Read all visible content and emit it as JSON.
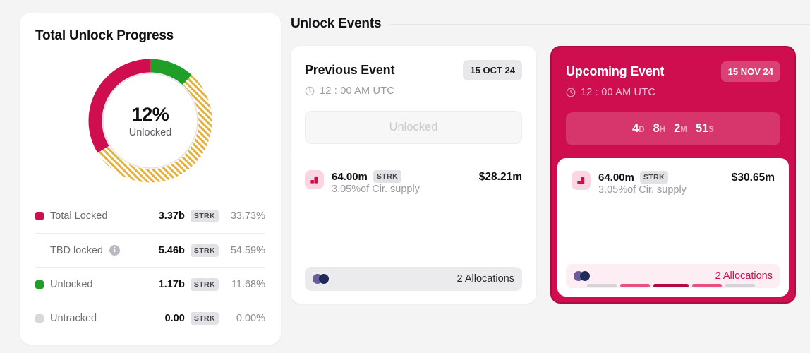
{
  "progress": {
    "title": "Total Unlock Progress",
    "donut": {
      "percent": "12%",
      "label": "Unlocked"
    },
    "colors": {
      "total_locked": "#ce0e4e",
      "tbd_locked": "#e5b13a",
      "unlocked": "#1f9e28",
      "untracked": "#d8d8dc"
    },
    "legend": [
      {
        "name": "Total Locked",
        "value": "3.37b",
        "unit": "STRK",
        "percent": "33.73%",
        "swatch": "sw-locked",
        "info": false
      },
      {
        "name": "TBD locked",
        "value": "5.46b",
        "unit": "STRK",
        "percent": "54.59%",
        "swatch": "sw-tbd",
        "info": true
      },
      {
        "name": "Unlocked",
        "value": "1.17b",
        "unit": "STRK",
        "percent": "11.68%",
        "swatch": "sw-unlocked",
        "info": false
      },
      {
        "name": "Untracked",
        "value": "0.00",
        "unit": "STRK",
        "percent": "0.00%",
        "swatch": "sw-untracked",
        "info": false
      }
    ]
  },
  "events": {
    "title": "Unlock Events",
    "previous": {
      "name": "Previous Event",
      "date": "15 OCT 24",
      "time": "12 : 00 AM UTC",
      "status": "Unlocked",
      "allocation": {
        "amount": "64.00m",
        "unit": "STRK",
        "supply": "3.05%of Cir. supply",
        "usd": "$28.21m",
        "footer": "2 Allocations"
      }
    },
    "upcoming": {
      "name": "Upcoming Event",
      "date": "15 NOV 24",
      "time": "12 : 00 AM UTC",
      "countdown": {
        "days": "4",
        "days_unit": "D",
        "hours": "8",
        "hours_unit": "H",
        "minutes": "2",
        "minutes_unit": "M",
        "seconds": "51",
        "seconds_unit": "S"
      },
      "allocation": {
        "amount": "64.00m",
        "unit": "STRK",
        "supply": "3.05%of Cir. supply",
        "usd": "$30.65m",
        "footer": "2 Allocations"
      }
    }
  },
  "pagination": {
    "count": 5,
    "active_index": 2
  },
  "chart_data": {
    "type": "pie",
    "title": "Total Unlock Progress",
    "center_value": "12%",
    "center_label": "Unlocked",
    "categories": [
      "Unlocked",
      "TBD locked",
      "Total Locked",
      "Untracked"
    ],
    "values": [
      11.68,
      54.59,
      33.73,
      0.0
    ],
    "value_labels": [
      "1.17b STRK",
      "5.46b STRK",
      "3.37b STRK",
      "0.00 STRK"
    ],
    "colors": [
      "#1f9e28",
      "#e5b13a",
      "#ce0e4e",
      "#d8d8dc"
    ],
    "unit": "STRK",
    "legend": "right-list",
    "start_angle_deg": -90,
    "direction": "clockwise",
    "hatched_slices": [
      "TBD locked"
    ]
  }
}
